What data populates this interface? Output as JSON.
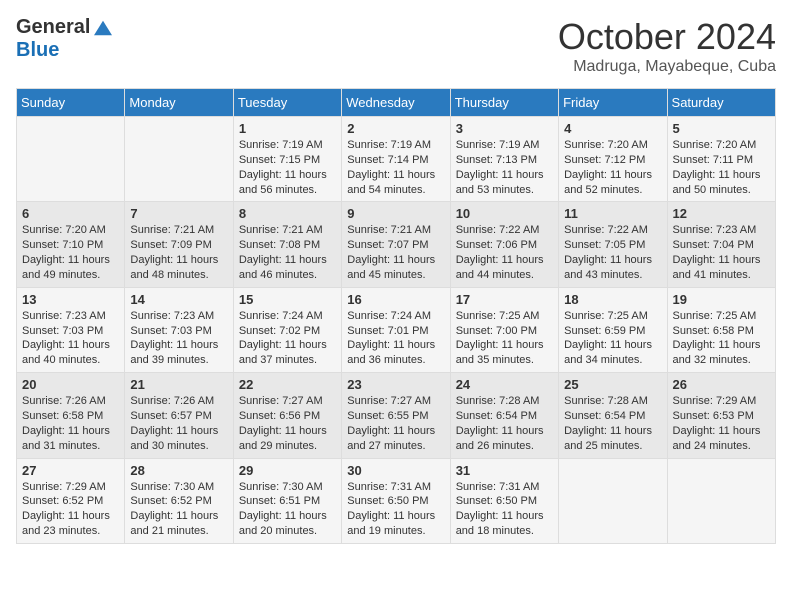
{
  "logo": {
    "general": "General",
    "blue": "Blue"
  },
  "header": {
    "month": "October 2024",
    "location": "Madruga, Mayabeque, Cuba"
  },
  "days_of_week": [
    "Sunday",
    "Monday",
    "Tuesday",
    "Wednesday",
    "Thursday",
    "Friday",
    "Saturday"
  ],
  "weeks": [
    [
      {
        "day": "",
        "sunrise": "",
        "sunset": "",
        "daylight": ""
      },
      {
        "day": "",
        "sunrise": "",
        "sunset": "",
        "daylight": ""
      },
      {
        "day": "1",
        "sunrise": "Sunrise: 7:19 AM",
        "sunset": "Sunset: 7:15 PM",
        "daylight": "Daylight: 11 hours and 56 minutes."
      },
      {
        "day": "2",
        "sunrise": "Sunrise: 7:19 AM",
        "sunset": "Sunset: 7:14 PM",
        "daylight": "Daylight: 11 hours and 54 minutes."
      },
      {
        "day": "3",
        "sunrise": "Sunrise: 7:19 AM",
        "sunset": "Sunset: 7:13 PM",
        "daylight": "Daylight: 11 hours and 53 minutes."
      },
      {
        "day": "4",
        "sunrise": "Sunrise: 7:20 AM",
        "sunset": "Sunset: 7:12 PM",
        "daylight": "Daylight: 11 hours and 52 minutes."
      },
      {
        "day": "5",
        "sunrise": "Sunrise: 7:20 AM",
        "sunset": "Sunset: 7:11 PM",
        "daylight": "Daylight: 11 hours and 50 minutes."
      }
    ],
    [
      {
        "day": "6",
        "sunrise": "Sunrise: 7:20 AM",
        "sunset": "Sunset: 7:10 PM",
        "daylight": "Daylight: 11 hours and 49 minutes."
      },
      {
        "day": "7",
        "sunrise": "Sunrise: 7:21 AM",
        "sunset": "Sunset: 7:09 PM",
        "daylight": "Daylight: 11 hours and 48 minutes."
      },
      {
        "day": "8",
        "sunrise": "Sunrise: 7:21 AM",
        "sunset": "Sunset: 7:08 PM",
        "daylight": "Daylight: 11 hours and 46 minutes."
      },
      {
        "day": "9",
        "sunrise": "Sunrise: 7:21 AM",
        "sunset": "Sunset: 7:07 PM",
        "daylight": "Daylight: 11 hours and 45 minutes."
      },
      {
        "day": "10",
        "sunrise": "Sunrise: 7:22 AM",
        "sunset": "Sunset: 7:06 PM",
        "daylight": "Daylight: 11 hours and 44 minutes."
      },
      {
        "day": "11",
        "sunrise": "Sunrise: 7:22 AM",
        "sunset": "Sunset: 7:05 PM",
        "daylight": "Daylight: 11 hours and 43 minutes."
      },
      {
        "day": "12",
        "sunrise": "Sunrise: 7:23 AM",
        "sunset": "Sunset: 7:04 PM",
        "daylight": "Daylight: 11 hours and 41 minutes."
      }
    ],
    [
      {
        "day": "13",
        "sunrise": "Sunrise: 7:23 AM",
        "sunset": "Sunset: 7:03 PM",
        "daylight": "Daylight: 11 hours and 40 minutes."
      },
      {
        "day": "14",
        "sunrise": "Sunrise: 7:23 AM",
        "sunset": "Sunset: 7:03 PM",
        "daylight": "Daylight: 11 hours and 39 minutes."
      },
      {
        "day": "15",
        "sunrise": "Sunrise: 7:24 AM",
        "sunset": "Sunset: 7:02 PM",
        "daylight": "Daylight: 11 hours and 37 minutes."
      },
      {
        "day": "16",
        "sunrise": "Sunrise: 7:24 AM",
        "sunset": "Sunset: 7:01 PM",
        "daylight": "Daylight: 11 hours and 36 minutes."
      },
      {
        "day": "17",
        "sunrise": "Sunrise: 7:25 AM",
        "sunset": "Sunset: 7:00 PM",
        "daylight": "Daylight: 11 hours and 35 minutes."
      },
      {
        "day": "18",
        "sunrise": "Sunrise: 7:25 AM",
        "sunset": "Sunset: 6:59 PM",
        "daylight": "Daylight: 11 hours and 34 minutes."
      },
      {
        "day": "19",
        "sunrise": "Sunrise: 7:25 AM",
        "sunset": "Sunset: 6:58 PM",
        "daylight": "Daylight: 11 hours and 32 minutes."
      }
    ],
    [
      {
        "day": "20",
        "sunrise": "Sunrise: 7:26 AM",
        "sunset": "Sunset: 6:58 PM",
        "daylight": "Daylight: 11 hours and 31 minutes."
      },
      {
        "day": "21",
        "sunrise": "Sunrise: 7:26 AM",
        "sunset": "Sunset: 6:57 PM",
        "daylight": "Daylight: 11 hours and 30 minutes."
      },
      {
        "day": "22",
        "sunrise": "Sunrise: 7:27 AM",
        "sunset": "Sunset: 6:56 PM",
        "daylight": "Daylight: 11 hours and 29 minutes."
      },
      {
        "day": "23",
        "sunrise": "Sunrise: 7:27 AM",
        "sunset": "Sunset: 6:55 PM",
        "daylight": "Daylight: 11 hours and 27 minutes."
      },
      {
        "day": "24",
        "sunrise": "Sunrise: 7:28 AM",
        "sunset": "Sunset: 6:54 PM",
        "daylight": "Daylight: 11 hours and 26 minutes."
      },
      {
        "day": "25",
        "sunrise": "Sunrise: 7:28 AM",
        "sunset": "Sunset: 6:54 PM",
        "daylight": "Daylight: 11 hours and 25 minutes."
      },
      {
        "day": "26",
        "sunrise": "Sunrise: 7:29 AM",
        "sunset": "Sunset: 6:53 PM",
        "daylight": "Daylight: 11 hours and 24 minutes."
      }
    ],
    [
      {
        "day": "27",
        "sunrise": "Sunrise: 7:29 AM",
        "sunset": "Sunset: 6:52 PM",
        "daylight": "Daylight: 11 hours and 23 minutes."
      },
      {
        "day": "28",
        "sunrise": "Sunrise: 7:30 AM",
        "sunset": "Sunset: 6:52 PM",
        "daylight": "Daylight: 11 hours and 21 minutes."
      },
      {
        "day": "29",
        "sunrise": "Sunrise: 7:30 AM",
        "sunset": "Sunset: 6:51 PM",
        "daylight": "Daylight: 11 hours and 20 minutes."
      },
      {
        "day": "30",
        "sunrise": "Sunrise: 7:31 AM",
        "sunset": "Sunset: 6:50 PM",
        "daylight": "Daylight: 11 hours and 19 minutes."
      },
      {
        "day": "31",
        "sunrise": "Sunrise: 7:31 AM",
        "sunset": "Sunset: 6:50 PM",
        "daylight": "Daylight: 11 hours and 18 minutes."
      },
      {
        "day": "",
        "sunrise": "",
        "sunset": "",
        "daylight": ""
      },
      {
        "day": "",
        "sunrise": "",
        "sunset": "",
        "daylight": ""
      }
    ]
  ]
}
